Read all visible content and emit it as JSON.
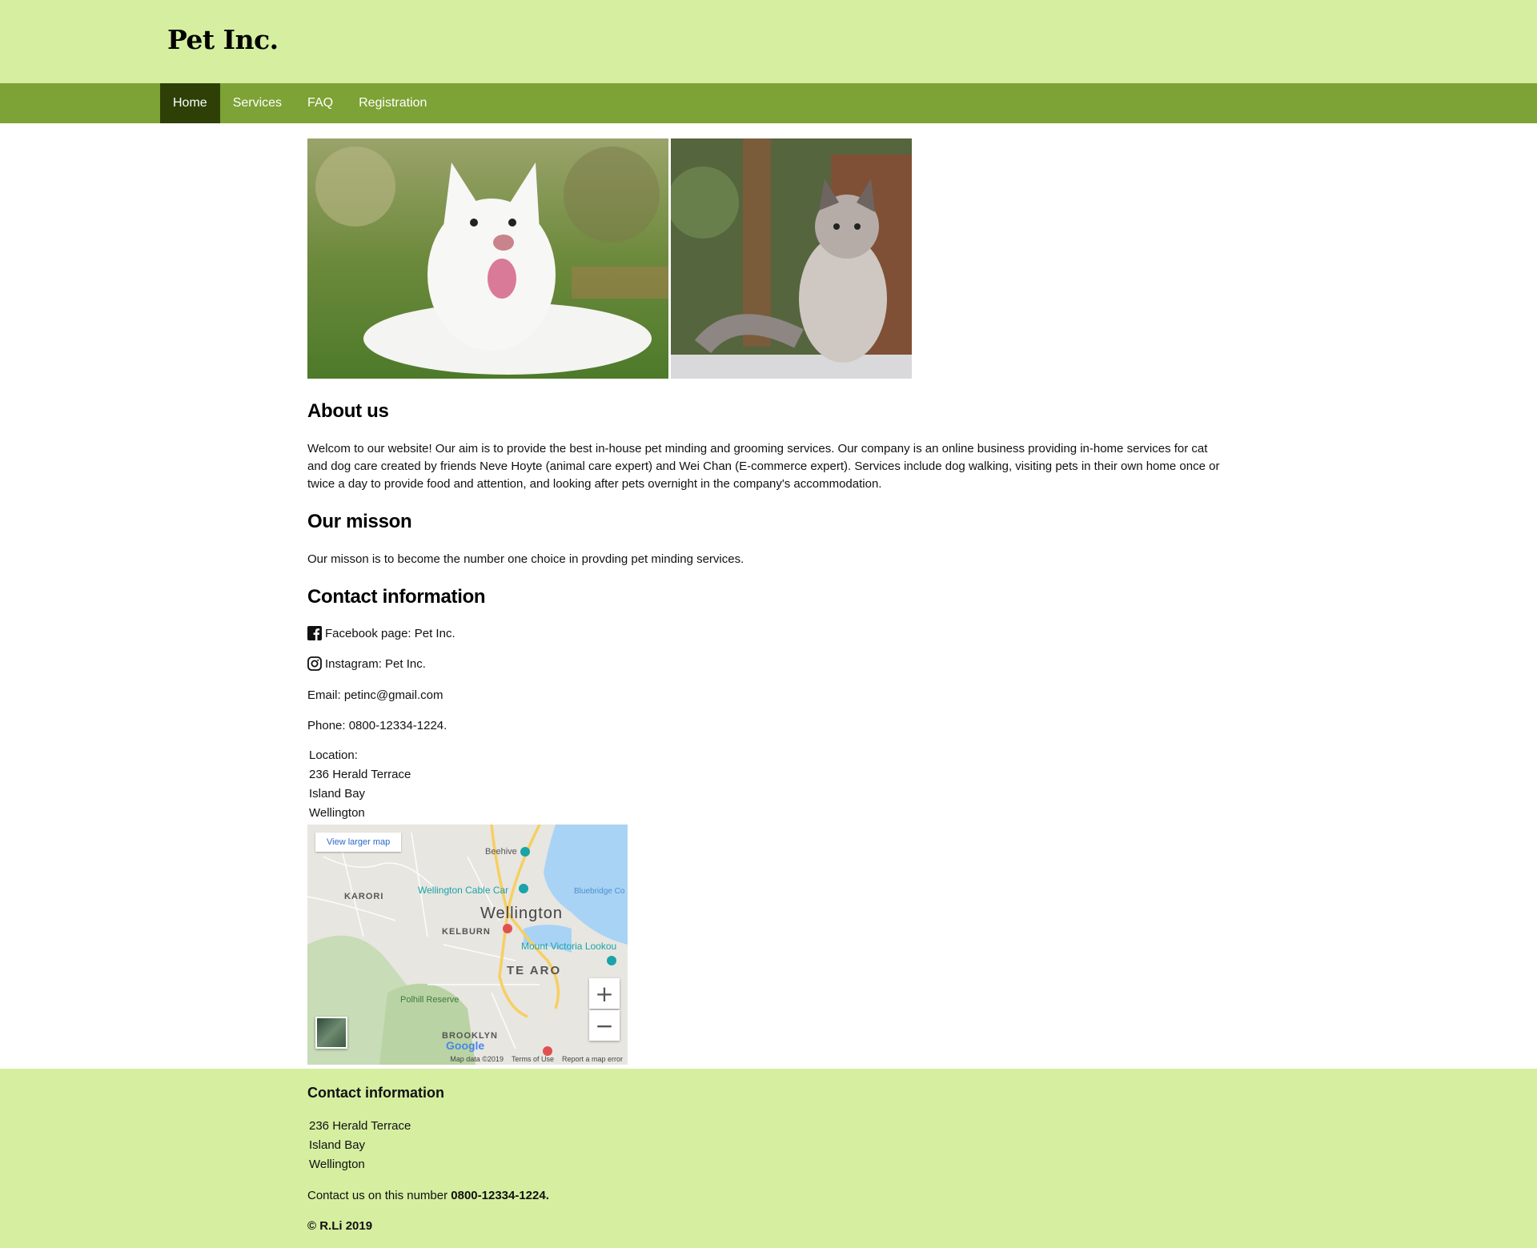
{
  "brand": {
    "logo": "Pet Inc."
  },
  "nav": {
    "items": [
      {
        "label": "Home",
        "active": true
      },
      {
        "label": "Services",
        "active": false
      },
      {
        "label": "FAQ",
        "active": false
      },
      {
        "label": "Registration",
        "active": false
      }
    ]
  },
  "about": {
    "heading": "About us",
    "text": "Welcom to our website! Our aim is to provide the best in-house pet minding and grooming services. Our company is an online business providing in-home services for cat and dog care created by friends Neve Hoyte (animal care expert) and Wei Chan (E-commerce expert). Services include dog walking, visiting pets in their own home once or twice a day to provide food and attention, and looking after pets overnight in the company's accommodation."
  },
  "mission": {
    "heading": "Our misson",
    "text": "Our misson is to become the number one choice in provding pet minding services."
  },
  "contact": {
    "heading": "Contact information",
    "facebook": "Facebook page: Pet Inc.",
    "instagram": "Instagram: Pet Inc.",
    "email": "Email: petinc@gmail.com",
    "phone": "Phone: 0800-12334-1224.",
    "location_label": "Location:",
    "address": [
      "236 Herald Terrace",
      "Island Bay",
      "Wellington"
    ]
  },
  "map": {
    "view_larger": "View larger map",
    "labels": {
      "beehive": "Beehive",
      "karori": "KARORI",
      "cable_car": "Wellington Cable Car",
      "bluebridge": "Bluebridge Co",
      "wellington": "Wellington",
      "kelburn": "KELBURN",
      "mount_victoria": "Mount Victoria Lookou",
      "te_aro": "TE ARO",
      "polhill": "Polhill Reserve",
      "brooklyn": "BROOKLYN",
      "google": "Google"
    },
    "footer": {
      "data": "Map data ©2019",
      "terms": "Terms of Use",
      "report": "Report a map error"
    },
    "zoom_in": "+",
    "zoom_out": "−"
  },
  "footer": {
    "heading": "Contact information",
    "address": [
      "236 Herald Terrace",
      "Island Bay",
      "Wellington"
    ],
    "call_prefix": "Contact us on this number ",
    "call_number": "0800-12334-1224.",
    "copyright": "© R.Li 2019"
  },
  "colors": {
    "header_bg": "#d5eea0",
    "nav_bg": "#7da235",
    "nav_active": "#2e4006"
  }
}
